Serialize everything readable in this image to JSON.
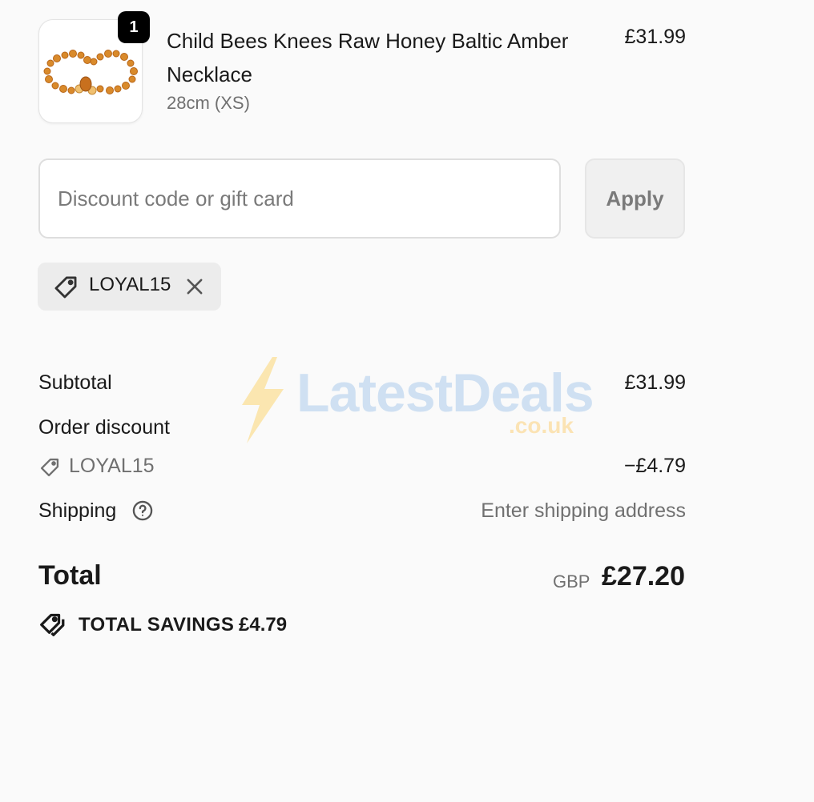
{
  "item": {
    "quantity": "1",
    "title": "Child Bees Knees Raw Honey Baltic Amber Necklace",
    "variant": "28cm (XS)",
    "price": "£31.99"
  },
  "discount": {
    "placeholder": "Discount code or gift card",
    "apply_label": "Apply",
    "applied_code": "LOYAL15"
  },
  "summary": {
    "subtotal_label": "Subtotal",
    "subtotal_value": "£31.99",
    "order_discount_label": "Order discount",
    "discount_code": "LOYAL15",
    "discount_value": "−£4.79",
    "shipping_label": "Shipping",
    "shipping_value": "Enter shipping address",
    "total_label": "Total",
    "currency": "GBP",
    "total_value": "£27.20",
    "savings_label": "TOTAL SAVINGS",
    "savings_value": "£4.79"
  },
  "watermark": {
    "brand": "LatestDeals",
    "domain": ".co.uk"
  },
  "icons": {
    "tag": "tag-icon",
    "remove": "close-icon",
    "help": "question-circle-icon",
    "savings": "tags-icon"
  },
  "colors": {
    "text": "#1a1a1a",
    "muted": "#707070",
    "background": "#fafafa",
    "badge": "#000000"
  }
}
